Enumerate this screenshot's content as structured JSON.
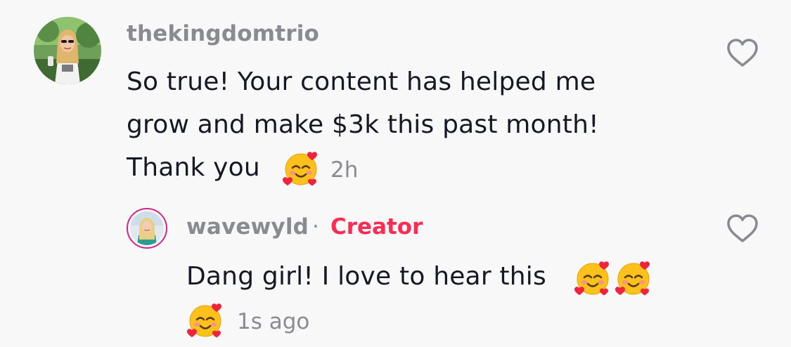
{
  "comment": {
    "username": "thekingdomtrio",
    "text_lines": [
      "So true! Your content has helped me",
      "grow and make $3k this past month!",
      "Thank you"
    ],
    "emoji": "smiling-face-with-hearts",
    "timestamp": "2h"
  },
  "reply": {
    "username": "wavewyld",
    "separator": "·",
    "badge": "Creator",
    "text_lines": [
      "Dang girl! I love to hear this"
    ],
    "emoji": "smiling-face-with-hearts",
    "timestamp": "1s ago"
  },
  "colors": {
    "background": "#f8f8f8",
    "text": "#161823",
    "secondary": "#8a8b91",
    "creator": "#fe2c55",
    "creator_ring": "#d2238c"
  }
}
